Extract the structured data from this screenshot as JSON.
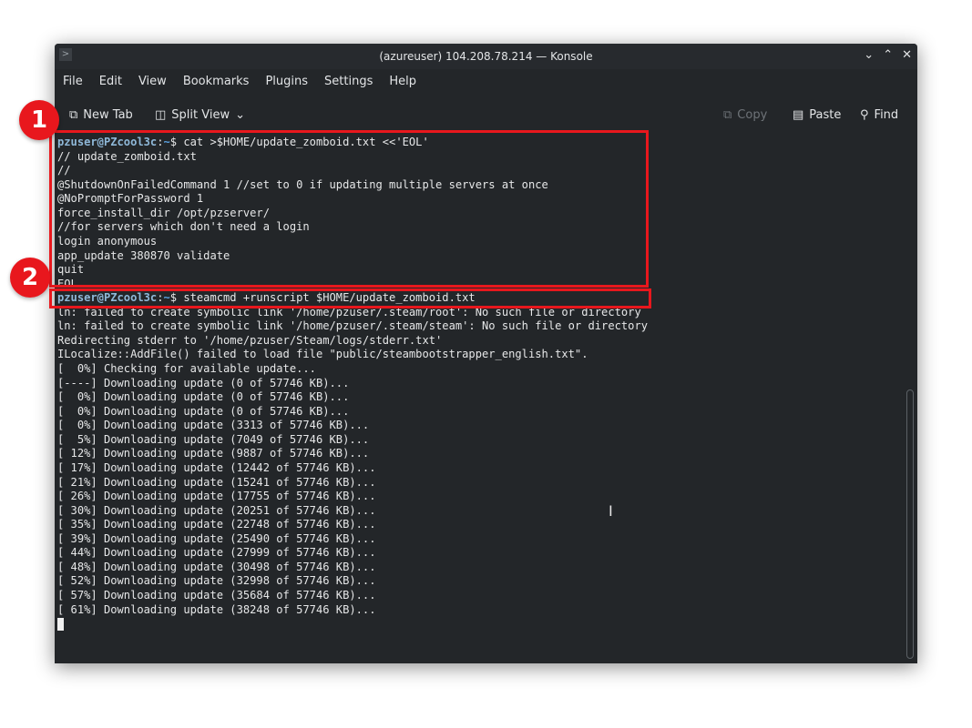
{
  "window": {
    "title": "(azureuser) 104.208.78.214 — Konsole"
  },
  "menu": [
    "File",
    "Edit",
    "View",
    "Bookmarks",
    "Plugins",
    "Settings",
    "Help"
  ],
  "toolbar": {
    "new_tab": "New Tab",
    "split_view": "Split View",
    "copy": "Copy",
    "paste": "Paste",
    "find": "Find"
  },
  "prompt": {
    "user_host": "pzuser@PZcool3c",
    "sep": ":",
    "dir": "~",
    "sigil": "$"
  },
  "commands": [
    "cat >$HOME/update_zomboid.txt <<'EOL'",
    "steamcmd +runscript $HOME/update_zomboid.txt"
  ],
  "heredoc": [
    "// update_zomboid.txt",
    "//",
    "@ShutdownOnFailedCommand 1 //set to 0 if updating multiple servers at once",
    "@NoPromptForPassword 1",
    "force_install_dir /opt/pzserver/",
    "//for servers which don't need a login",
    "login anonymous",
    "app_update 380870 validate",
    "quit",
    "EOL"
  ],
  "output": [
    "ln: failed to create symbolic link '/home/pzuser/.steam/root': No such file or directory",
    "ln: failed to create symbolic link '/home/pzuser/.steam/steam': No such file or directory",
    "Redirecting stderr to '/home/pzuser/Steam/logs/stderr.txt'",
    "ILocalize::AddFile() failed to load file \"public/steambootstrapper_english.txt\".",
    "[  0%] Checking for available update...",
    "[----] Downloading update (0 of 57746 KB)...",
    "[  0%] Downloading update (0 of 57746 KB)...",
    "[  0%] Downloading update (0 of 57746 KB)...",
    "[  0%] Downloading update (3313 of 57746 KB)...",
    "[  5%] Downloading update (7049 of 57746 KB)...",
    "[ 12%] Downloading update (9887 of 57746 KB)...",
    "[ 17%] Downloading update (12442 of 57746 KB)...",
    "[ 21%] Downloading update (15241 of 57746 KB)...",
    "[ 26%] Downloading update (17755 of 57746 KB)...",
    "[ 30%] Downloading update (20251 of 57746 KB)...",
    "[ 35%] Downloading update (22748 of 57746 KB)...",
    "[ 39%] Downloading update (25490 of 57746 KB)...",
    "[ 44%] Downloading update (27999 of 57746 KB)...",
    "[ 48%] Downloading update (30498 of 57746 KB)...",
    "[ 52%] Downloading update (32998 of 57746 KB)...",
    "[ 57%] Downloading update (35684 of 57746 KB)...",
    "[ 61%] Downloading update (38248 of 57746 KB)..."
  ],
  "annotations": [
    "1",
    "2"
  ],
  "colors": {
    "terminal_bg": "#232629",
    "highlight": "#e8171d",
    "prompt": "#8fb8d8"
  }
}
